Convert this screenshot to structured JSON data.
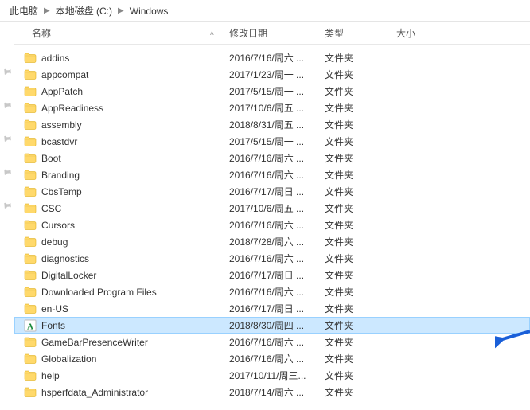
{
  "breadcrumb": {
    "segments": [
      "此电脑",
      "本地磁盘 (C:)",
      "Windows"
    ]
  },
  "columns": {
    "name": "名称",
    "date": "修改日期",
    "type": "类型",
    "size": "大小"
  },
  "items": [
    {
      "name": "addins",
      "date": "2016/7/16/周六 ...",
      "type": "文件夹",
      "icon": "folder"
    },
    {
      "name": "appcompat",
      "date": "2017/1/23/周一 ...",
      "type": "文件夹",
      "icon": "folder"
    },
    {
      "name": "AppPatch",
      "date": "2017/5/15/周一 ...",
      "type": "文件夹",
      "icon": "folder"
    },
    {
      "name": "AppReadiness",
      "date": "2017/10/6/周五 ...",
      "type": "文件夹",
      "icon": "folder"
    },
    {
      "name": "assembly",
      "date": "2018/8/31/周五 ...",
      "type": "文件夹",
      "icon": "folder"
    },
    {
      "name": "bcastdvr",
      "date": "2017/5/15/周一 ...",
      "type": "文件夹",
      "icon": "folder"
    },
    {
      "name": "Boot",
      "date": "2016/7/16/周六 ...",
      "type": "文件夹",
      "icon": "folder"
    },
    {
      "name": "Branding",
      "date": "2016/7/16/周六 ...",
      "type": "文件夹",
      "icon": "folder"
    },
    {
      "name": "CbsTemp",
      "date": "2016/7/17/周日 ...",
      "type": "文件夹",
      "icon": "folder"
    },
    {
      "name": "CSC",
      "date": "2017/10/6/周五 ...",
      "type": "文件夹",
      "icon": "folder"
    },
    {
      "name": "Cursors",
      "date": "2016/7/16/周六 ...",
      "type": "文件夹",
      "icon": "folder"
    },
    {
      "name": "debug",
      "date": "2018/7/28/周六 ...",
      "type": "文件夹",
      "icon": "folder"
    },
    {
      "name": "diagnostics",
      "date": "2016/7/16/周六 ...",
      "type": "文件夹",
      "icon": "folder"
    },
    {
      "name": "DigitalLocker",
      "date": "2016/7/17/周日 ...",
      "type": "文件夹",
      "icon": "folder"
    },
    {
      "name": "Downloaded Program Files",
      "date": "2016/7/16/周六 ...",
      "type": "文件夹",
      "icon": "folder"
    },
    {
      "name": "en-US",
      "date": "2016/7/17/周日 ...",
      "type": "文件夹",
      "icon": "folder"
    },
    {
      "name": "Fonts",
      "date": "2018/8/30/周四 ...",
      "type": "文件夹",
      "icon": "fonts",
      "selected": true
    },
    {
      "name": "GameBarPresenceWriter",
      "date": "2016/7/16/周六 ...",
      "type": "文件夹",
      "icon": "folder"
    },
    {
      "name": "Globalization",
      "date": "2016/7/16/周六 ...",
      "type": "文件夹",
      "icon": "folder"
    },
    {
      "name": "help",
      "date": "2017/10/11/周三...",
      "type": "文件夹",
      "icon": "folder"
    },
    {
      "name": "hsperfdata_Administrator",
      "date": "2018/7/14/周六 ...",
      "type": "文件夹",
      "icon": "folder"
    }
  ]
}
